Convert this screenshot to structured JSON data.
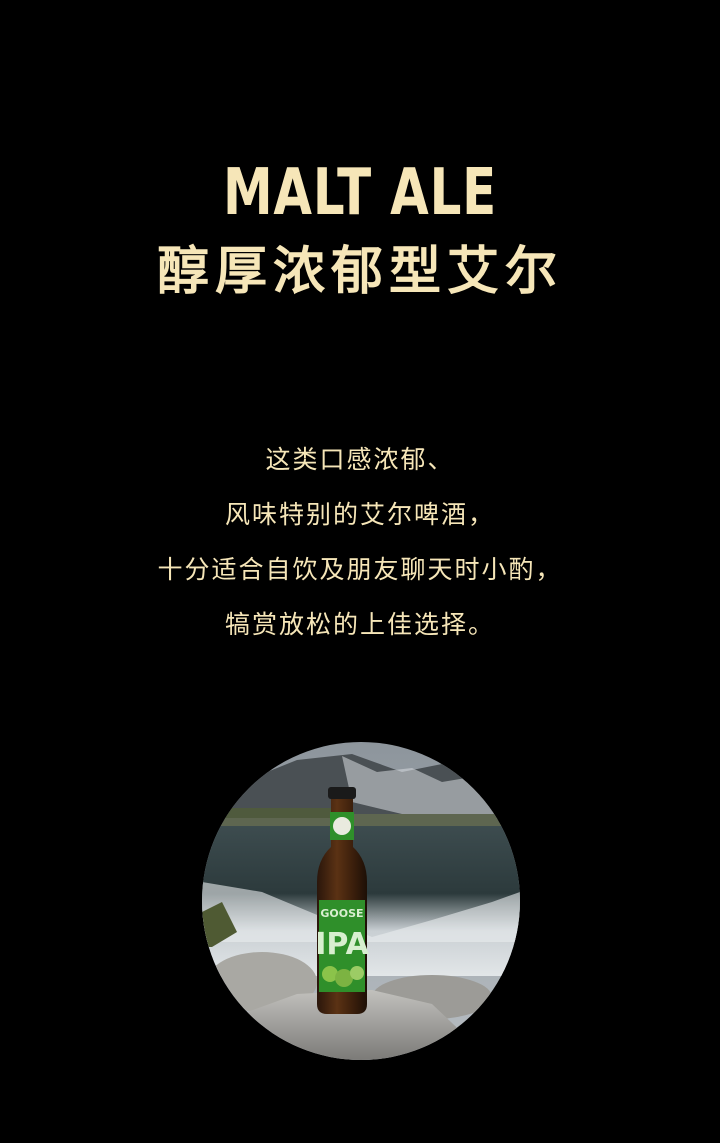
{
  "heading": {
    "title_en": "MALT ALE",
    "title_cn": "醇厚浓郁型艾尔"
  },
  "description": {
    "lines": [
      "这类口感浓郁、",
      "风味特别的艾尔啤酒，",
      "十分适合自饮及朋友聊天时小酌，",
      "犒赏放松的上佳选择。"
    ]
  },
  "photo": {
    "label_brand": "GOOSE",
    "label_style": "IPA"
  },
  "colors": {
    "background": "#000000",
    "accent_text": "#f6e6b8",
    "label_green": "#2f8f2a"
  }
}
